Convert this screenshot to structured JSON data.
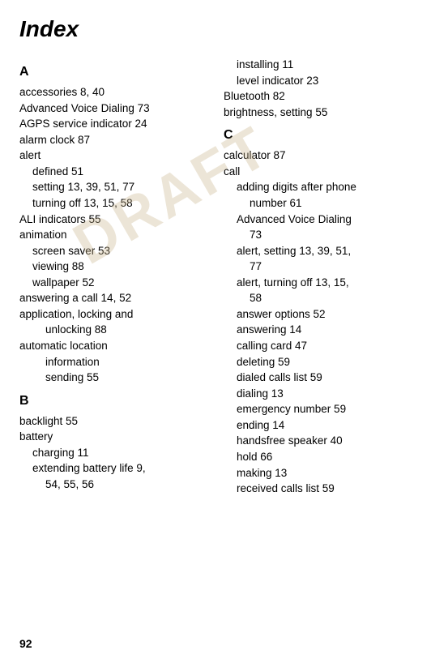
{
  "page": {
    "title": "Index",
    "footer_page_number": "92"
  },
  "watermark": "DRAFT",
  "left_column": {
    "sections": [
      {
        "letter": "A",
        "entries": [
          {
            "text": "accessories  8, 40",
            "indent": 0
          },
          {
            "text": "Advanced Voice Dialing  73",
            "indent": 0
          },
          {
            "text": "AGPS service indicator  24",
            "indent": 0
          },
          {
            "text": "alarm clock  87",
            "indent": 0
          },
          {
            "text": "alert",
            "indent": 0
          },
          {
            "text": "defined  51",
            "indent": 1
          },
          {
            "text": "setting  13, 39, 51, 77",
            "indent": 1
          },
          {
            "text": "turning off  13, 15, 58",
            "indent": 1
          },
          {
            "text": "ALI indicators  55",
            "indent": 0
          },
          {
            "text": "animation",
            "indent": 0
          },
          {
            "text": "screen saver  53",
            "indent": 1
          },
          {
            "text": "viewing  88",
            "indent": 1
          },
          {
            "text": "wallpaper  52",
            "indent": 1
          },
          {
            "text": "answering a call  14, 52",
            "indent": 0
          },
          {
            "text": "application, locking and",
            "indent": 0
          },
          {
            "text": "unlocking  88",
            "indent": 2
          },
          {
            "text": "automatic location",
            "indent": 0
          },
          {
            "text": "information",
            "indent": 2
          },
          {
            "text": "sending  55",
            "indent": 2
          }
        ]
      },
      {
        "letter": "B",
        "entries": [
          {
            "text": "backlight  55",
            "indent": 0
          },
          {
            "text": "battery",
            "indent": 0
          },
          {
            "text": "charging  11",
            "indent": 1
          },
          {
            "text": "extending battery life  9,",
            "indent": 1
          },
          {
            "text": "54, 55, 56",
            "indent": 2
          }
        ]
      }
    ]
  },
  "right_column": {
    "sections": [
      {
        "letter": "",
        "entries": [
          {
            "text": "installing  11",
            "indent": 1
          },
          {
            "text": "level indicator  23",
            "indent": 1
          },
          {
            "text": "Bluetooth  82",
            "indent": 0
          },
          {
            "text": "brightness, setting  55",
            "indent": 0
          }
        ]
      },
      {
        "letter": "C",
        "entries": [
          {
            "text": "calculator  87",
            "indent": 0
          },
          {
            "text": "call",
            "indent": 0
          },
          {
            "text": "adding digits after phone",
            "indent": 1
          },
          {
            "text": "number  61",
            "indent": 2
          },
          {
            "text": "Advanced Voice Dialing",
            "indent": 1
          },
          {
            "text": "73",
            "indent": 2
          },
          {
            "text": "alert, setting  13, 39, 51,",
            "indent": 1
          },
          {
            "text": "77",
            "indent": 2
          },
          {
            "text": "alert, turning off  13, 15,",
            "indent": 1
          },
          {
            "text": "58",
            "indent": 2
          },
          {
            "text": "answer options  52",
            "indent": 1
          },
          {
            "text": "answering  14",
            "indent": 1
          },
          {
            "text": "calling card  47",
            "indent": 1
          },
          {
            "text": "deleting  59",
            "indent": 1
          },
          {
            "text": "dialed calls list  59",
            "indent": 1
          },
          {
            "text": "dialing  13",
            "indent": 1
          },
          {
            "text": "emergency number  59",
            "indent": 1
          },
          {
            "text": "ending  14",
            "indent": 1
          },
          {
            "text": "handsfree speaker  40",
            "indent": 1
          },
          {
            "text": "hold  66",
            "indent": 1
          },
          {
            "text": "making  13",
            "indent": 1
          },
          {
            "text": "received calls list  59",
            "indent": 1
          }
        ]
      }
    ]
  }
}
